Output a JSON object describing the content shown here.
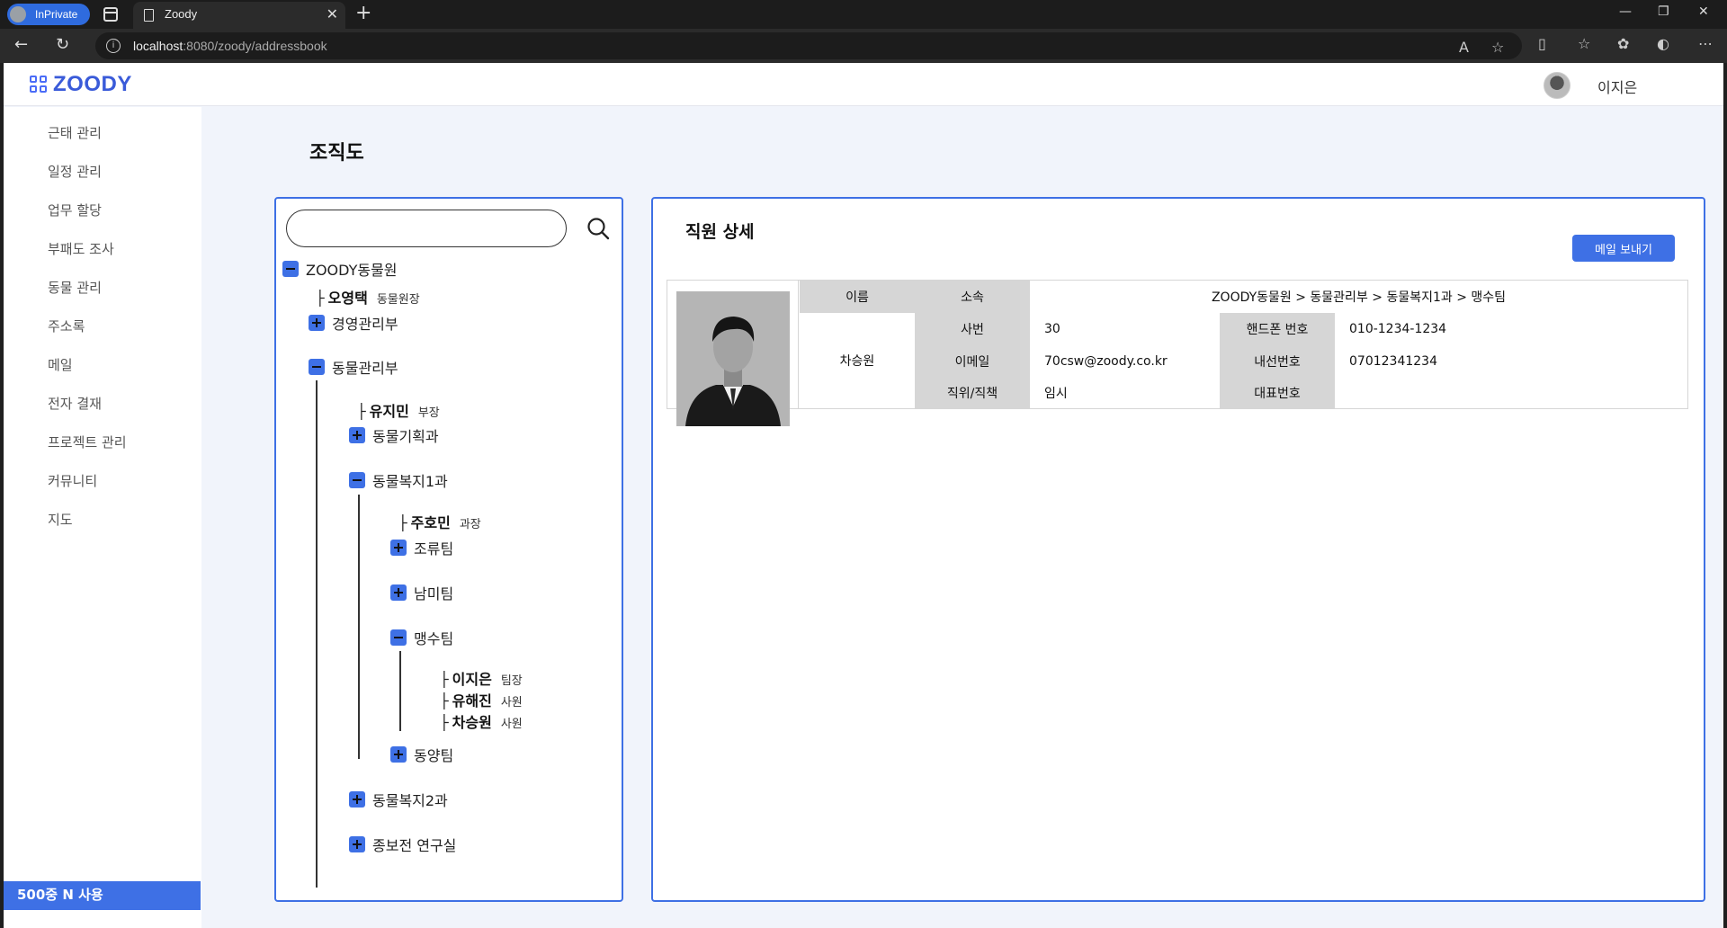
{
  "browser": {
    "inprivate_label": "InPrivate",
    "tab_title": "Zoody",
    "url_host": "localhost",
    "url_path": ":8080/zoody/addressbook"
  },
  "header": {
    "logo_text": "ZOODY",
    "user_name": "이지은"
  },
  "sidebar": {
    "items": [
      {
        "label": "근태 관리"
      },
      {
        "label": "일정 관리"
      },
      {
        "label": "업무 할당"
      },
      {
        "label": "부패도 조사"
      },
      {
        "label": "동물 관리"
      },
      {
        "label": "주소록"
      },
      {
        "label": "메일"
      },
      {
        "label": "전자 결재"
      },
      {
        "label": "프로젝트 관리"
      },
      {
        "label": "커뮤니티"
      },
      {
        "label": "지도"
      }
    ],
    "storage_text": "500중 N 사용"
  },
  "main": {
    "page_title": "조직도",
    "search": {
      "value": "",
      "placeholder": ""
    }
  },
  "tree": {
    "root": {
      "label": "ZOODY동물원",
      "state": "expanded"
    },
    "root_person": {
      "name": "오영택",
      "role": "동물원장"
    },
    "dept_mgmt": {
      "label": "경영관리부",
      "state": "collapsed"
    },
    "dept_animal": {
      "label": "동물관리부",
      "state": "expanded"
    },
    "dept_animal_person": {
      "name": "유지민",
      "role": "부장"
    },
    "sec_plan": {
      "label": "동물기획과",
      "state": "collapsed"
    },
    "sec_welfare1": {
      "label": "동물복지1과",
      "state": "expanded"
    },
    "sec_welfare1_person": {
      "name": "주호민",
      "role": "과장"
    },
    "team_bird": {
      "label": "조류팀",
      "state": "collapsed"
    },
    "team_southam": {
      "label": "남미팀",
      "state": "collapsed"
    },
    "team_beast": {
      "label": "맹수팀",
      "state": "expanded"
    },
    "team_beast_members": [
      {
        "name": "이지은",
        "role": "팀장"
      },
      {
        "name": "유해진",
        "role": "사원"
      },
      {
        "name": "차승원",
        "role": "사원"
      }
    ],
    "team_east": {
      "label": "동양팀",
      "state": "collapsed"
    },
    "sec_welfare2": {
      "label": "동물복지2과",
      "state": "collapsed"
    },
    "sec_research": {
      "label": "종보전 연구실",
      "state": "collapsed"
    }
  },
  "detail": {
    "title": "직원 상세",
    "mail_button": "메일 보내기",
    "labels": {
      "name": "이름",
      "affiliation": "소속",
      "emp_no": "사번",
      "phone": "핸드폰 번호",
      "email": "이메일",
      "extension": "내선번호",
      "position": "직위/직책",
      "main_number": "대표번호"
    },
    "values": {
      "name": "차승원",
      "affiliation": "ZOODY동물원 > 동물관리부 > 동물복지1과 > 맹수팀",
      "emp_no": "30",
      "phone": "010-1234-1234",
      "email": "70csw@zoody.co.kr",
      "extension": "07012341234",
      "position": "임시",
      "main_number": ""
    }
  },
  "colors": {
    "accent": "#3e70e5",
    "page_bg": "#f1f4fb",
    "label_cell": "#d6d6d6"
  }
}
